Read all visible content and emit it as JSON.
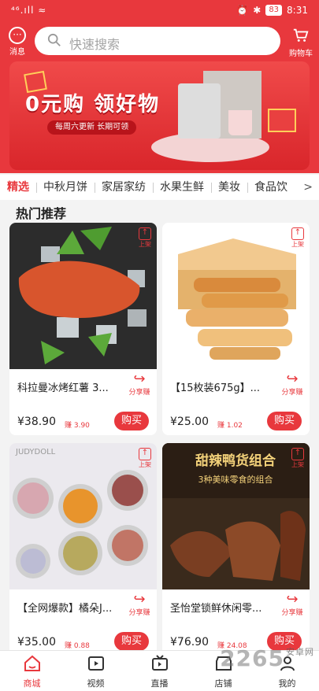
{
  "status": {
    "signal": "⁴⁶.ıll ≈",
    "battery": "83",
    "time": "8:31"
  },
  "header": {
    "message_label": "消息",
    "search_placeholder": "快速搜索",
    "cart_label": "购物车"
  },
  "banner": {
    "title": "0元购 领好物",
    "subtitle": "每周六更新 长期可领"
  },
  "tabs": [
    {
      "label": "精选",
      "active": true
    },
    {
      "label": "中秋月饼"
    },
    {
      "label": "家居家纺"
    },
    {
      "label": "水果生鲜"
    },
    {
      "label": "美妆"
    },
    {
      "label": "食品饮"
    }
  ],
  "tabs_more": ">",
  "section_title": "热门推荐",
  "products": [
    {
      "name": "科拉曼冰烤红薯 3...",
      "price": "¥38.90",
      "earn": "赚 3.90",
      "buy": "购买",
      "share": "分享赚",
      "top_tag": "上架"
    },
    {
      "name": "【15枚装675g】...",
      "price": "¥25.00",
      "earn": "赚 1.02",
      "buy": "购买",
      "share": "分享赚",
      "top_tag": "上架"
    },
    {
      "name": "【全网爆款】橘朵J...",
      "price": "¥35.00",
      "earn": "赚 0.88",
      "buy": "购买",
      "share": "分享赚",
      "top_tag": "上架",
      "brand": "JUDYDOLL"
    },
    {
      "name": "圣怡堂锁鲜休闲零...",
      "price": "¥76.90",
      "earn": "赚 24.08",
      "buy": "购买",
      "share": "分享赚",
      "top_tag": "上架",
      "img_text1": "甜辣鸭货组合",
      "img_text2": "3种美味零食的组合"
    }
  ],
  "nav": [
    {
      "label": "商城",
      "icon": "home-icon",
      "active": true
    },
    {
      "label": "视频",
      "icon": "video-icon"
    },
    {
      "label": "直播",
      "icon": "live-tv-icon"
    },
    {
      "label": "店铺",
      "icon": "shop-icon"
    },
    {
      "label": "我的",
      "icon": "user-icon"
    }
  ],
  "watermark": {
    "main": "2265",
    "sub": "安卓网"
  },
  "colors": {
    "brand": "#e8383d"
  }
}
